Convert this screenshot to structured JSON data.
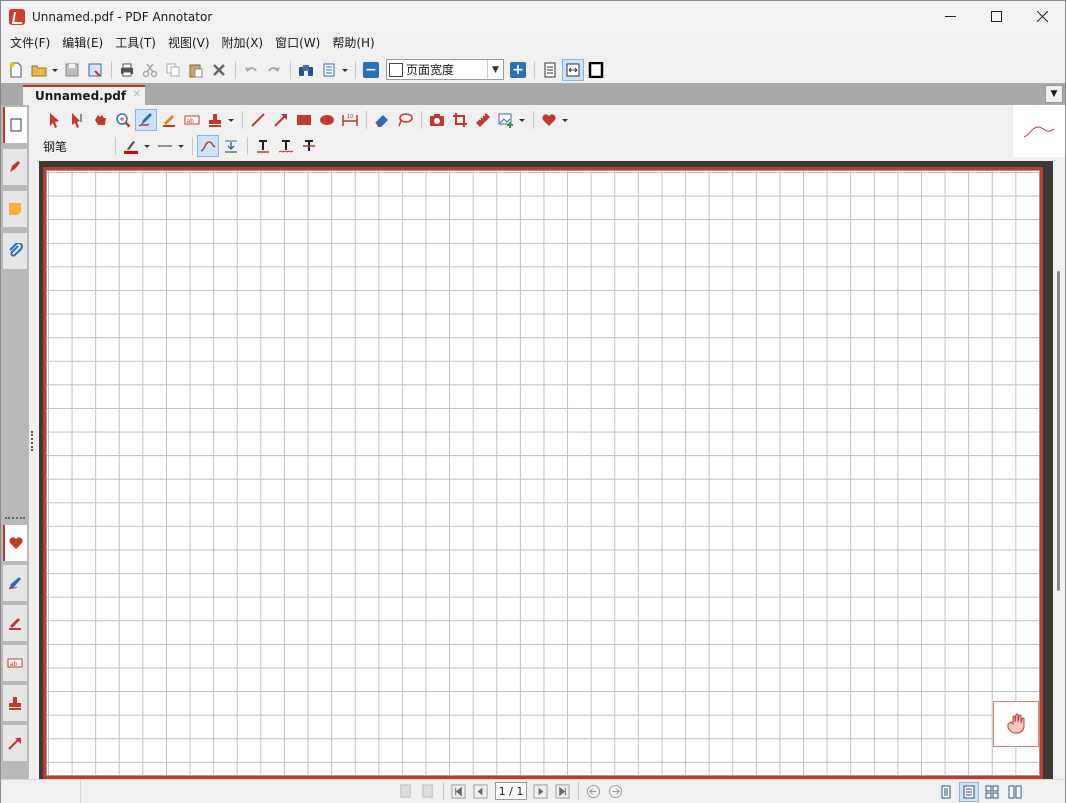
{
  "window": {
    "title": "Unnamed.pdf - PDF Annotator"
  },
  "menu": {
    "items": [
      "文件(F)",
      "编辑(E)",
      "工具(T)",
      "视图(V)",
      "附加(X)",
      "窗口(W)",
      "帮助(H)"
    ]
  },
  "toolbar": {
    "zoom_value": "页面宽度"
  },
  "tabs": {
    "active_label": "Unnamed.pdf"
  },
  "annotation_toolbar": {
    "tool_label": "钢笔"
  },
  "statusbar": {
    "page_indicator": "1 / 1"
  },
  "colors": {
    "accent": "#c0392b",
    "selection": "#cde3f7",
    "grid": "#bfbfbf"
  }
}
